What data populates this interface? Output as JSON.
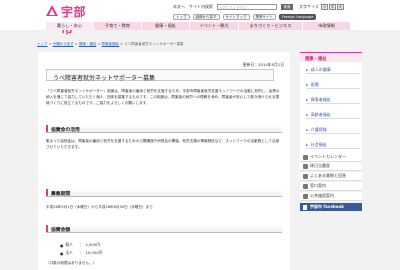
{
  "header": {
    "logo_text": "宇部市",
    "logo_sub": "Ube City",
    "util_links": [
      "本文へ",
      "サイト内検索"
    ],
    "search_placeholder": "入力してください",
    "search_button": "検索",
    "font_size_label": "文字サイズ",
    "font_sizes": [
      "小",
      "中",
      "大"
    ],
    "row2": [
      "トップ",
      "組織から探す",
      "サイトマップ",
      "携帯サイト",
      "Foreign Language"
    ]
  },
  "nav": {
    "tabs": [
      "暮らし・安心",
      "子育て・教育",
      "健康・福祉",
      "イベント・観光",
      "まちづくり・ビジネス",
      "市政情報"
    ]
  },
  "breadcrumb": {
    "items": [
      "トップ",
      "分類から探す",
      "健康・福祉",
      "障害者福祉"
    ],
    "current": "うべ障害者就労ネットサポーター募集"
  },
  "main": {
    "updated": "更新日：2014年5月1日",
    "title": "うべ障害者就労ネットサポーター募集",
    "intro": "「うべ障害者就労ネットサポーター」制度は、障害者の雇用と就労を支援するため、宇部市障害者就労支援ネットワークの活動に賛同し、会費の納入を通じて協力していただく個人・団体を募集するものです。この制度は、障害者の就労への理解を深め、障害者が安心して働き続けられる環境づくりに役立てるものです。ご協力をよろしくお願いします。",
    "sections": [
      {
        "heading": "協賛金の活用",
        "body": "集まった協賛金は、障害者の雇用と就労を支援するための公開講座や研修会の開催、就労支援の情報発信など、ネットワークの活動費として活用させていただきます。"
      },
      {
        "heading": "募集期間",
        "body": "平成26年5月1日（木曜日）から平成26年6月30日（月曜日）まで"
      },
      {
        "heading": "協賛金額",
        "fees": [
          {
            "label": "個人",
            "amount": "2,000円"
          },
          {
            "label": "法人",
            "amount": "10,000円"
          }
        ],
        "note": "（口数の制限はありません。）"
      }
    ]
  },
  "sidebar": {
    "heading": "健康・福祉",
    "items": [
      "成人の健康",
      "医療",
      "障害者福祉",
      "高齢者福祉",
      "介護保険",
      "社会福祉"
    ]
  },
  "side_links": [
    "イベントカレンダー",
    "休日当番医",
    "よくある質問と回答",
    "窓口案内",
    "公共施設案内"
  ],
  "facebook": "宇部市 facebook",
  "colors": {
    "accent": "#e4388b",
    "nav_bg": "#f9d7e6",
    "facebook": "#3b5998"
  }
}
